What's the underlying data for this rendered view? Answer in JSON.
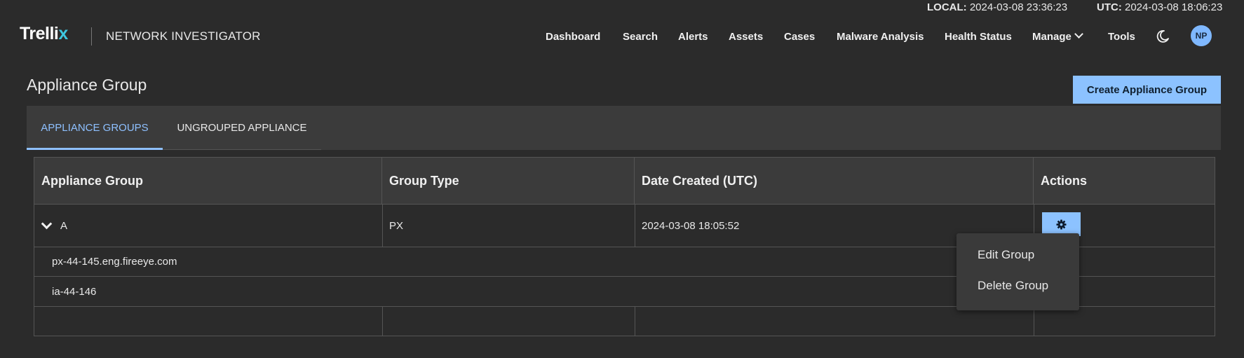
{
  "clock": {
    "local_label": "LOCAL:",
    "local_value": "2024-03-08 23:36:23",
    "utc_label": "UTC:",
    "utc_value": "2024-03-08 18:06:23"
  },
  "header": {
    "logo_text": "Trelli",
    "logo_mark": "x",
    "product_name": "NETWORK INVESTIGATOR",
    "nav": [
      "Dashboard",
      "Search",
      "Alerts",
      "Assets",
      "Cases",
      "Malware Analysis",
      "Health Status",
      "Manage",
      "Tools"
    ],
    "avatar_initials": "NP",
    "icons": {
      "theme_toggle": "moon-icon",
      "manage_dropdown": "chevron-down-icon"
    }
  },
  "page": {
    "title": "Appliance Group",
    "create_button": "Create Appliance Group"
  },
  "tabs": [
    {
      "label": "APPLIANCE GROUPS",
      "active": true
    },
    {
      "label": "UNGROUPED APPLIANCE",
      "active": false
    }
  ],
  "table": {
    "columns": [
      "Appliance Group",
      "Group Type",
      "Date Created (UTC)",
      "Actions"
    ],
    "group_row": {
      "name": "A",
      "type": "PX",
      "date_created": "2024-03-08 18:05:52"
    },
    "members": [
      "px-44-145.eng.fireeye.com",
      "ia-44-146"
    ]
  },
  "actions_menu": {
    "items": [
      "Edit Group",
      "Delete Group"
    ]
  },
  "colors": {
    "background": "#2b2b2b",
    "panel": "#3b3b3b",
    "accent": "#8cc2ff",
    "active_tab": "#8ec0ff",
    "logo_mark": "#3ec8e0"
  }
}
